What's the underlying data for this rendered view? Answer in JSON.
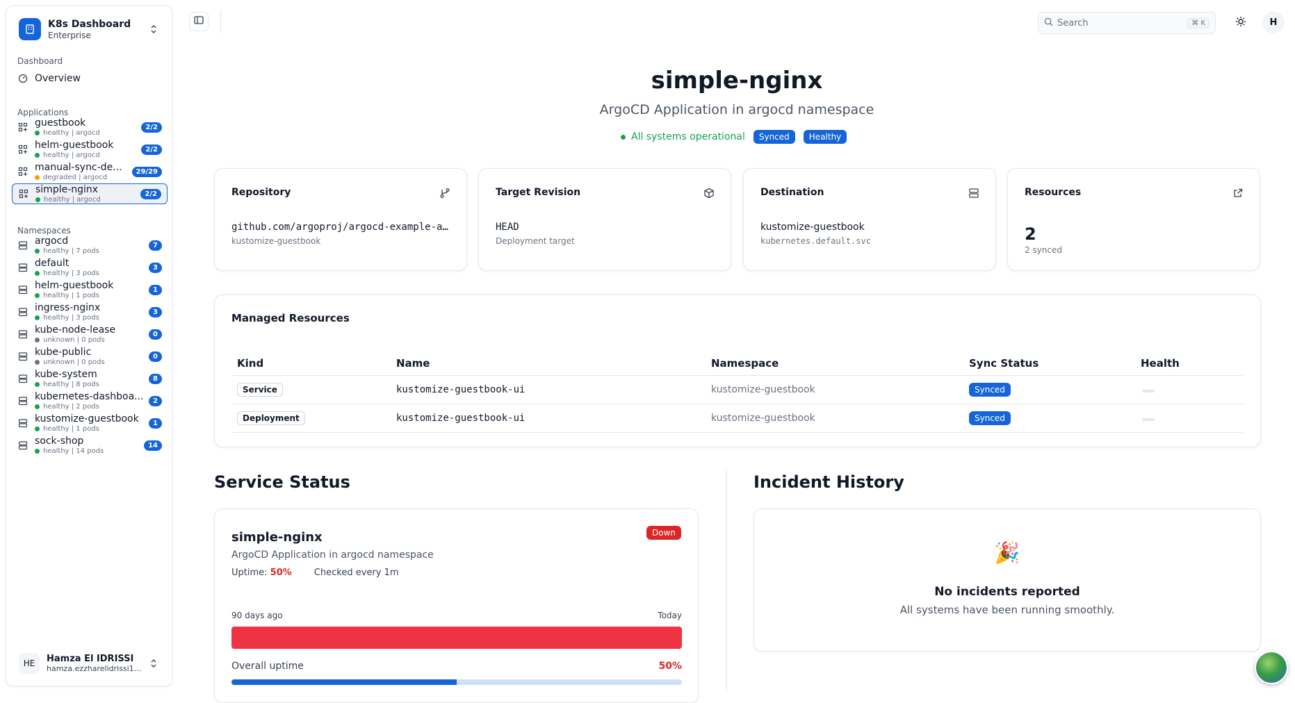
{
  "team": {
    "name": "K8s Dashboard",
    "plan": "Enterprise"
  },
  "sidebar": {
    "dashboard_label": "Dashboard",
    "overview_label": "Overview",
    "applications_label": "Applications",
    "applications": [
      {
        "name": "guestbook",
        "status": "healthy | argocd",
        "count": "2/2",
        "dot": "green"
      },
      {
        "name": "helm-guestbook",
        "status": "healthy | argocd",
        "count": "2/2",
        "dot": "green"
      },
      {
        "name": "manual-sync-de...",
        "status": "degraded | argocd",
        "count": "29/29",
        "dot": "orange"
      },
      {
        "name": "simple-nginx",
        "status": "healthy | argocd",
        "count": "2/2",
        "dot": "green",
        "active": true
      }
    ],
    "namespaces_label": "Namespaces",
    "namespaces": [
      {
        "name": "argocd",
        "status": "healthy | 7 pods",
        "count": "7",
        "dot": "green"
      },
      {
        "name": "default",
        "status": "healthy | 3 pods",
        "count": "3",
        "dot": "green"
      },
      {
        "name": "helm-guestbook",
        "status": "healthy | 1 pods",
        "count": "1",
        "dot": "green"
      },
      {
        "name": "ingress-nginx",
        "status": "healthy | 3 pods",
        "count": "3",
        "dot": "green"
      },
      {
        "name": "kube-node-lease",
        "status": "unknown | 0 pods",
        "count": "0",
        "dot": "gray"
      },
      {
        "name": "kube-public",
        "status": "unknown | 0 pods",
        "count": "0",
        "dot": "gray"
      },
      {
        "name": "kube-system",
        "status": "healthy | 8 pods",
        "count": "8",
        "dot": "green"
      },
      {
        "name": "kubernetes-dashboa...",
        "status": "healthy | 2 pods",
        "count": "2",
        "dot": "green"
      },
      {
        "name": "kustomize-guestbook",
        "status": "healthy | 1 pods",
        "count": "1",
        "dot": "green"
      },
      {
        "name": "sock-shop",
        "status": "healthy | 14 pods",
        "count": "14",
        "dot": "green"
      }
    ]
  },
  "user": {
    "initials": "HE",
    "name": "Hamza El IDRISSI",
    "email": "hamza.ezzharelidrissi1..."
  },
  "topbar": {
    "search_placeholder": "Search",
    "shortcut": "⌘ K",
    "avatar_initial": "H"
  },
  "hero": {
    "title": "simple-nginx",
    "subtitle": "ArgoCD Application in argocd namespace",
    "operational": "All systems operational",
    "badges": [
      "Synced",
      "Healthy"
    ]
  },
  "cards": {
    "repository": {
      "title": "Repository",
      "value": "github.com/argoproj/argocd-example-a...",
      "sub": "kustomize-guestbook",
      "icon": "git-branch-icon"
    },
    "revision": {
      "title": "Target Revision",
      "value": "HEAD",
      "sub": "Deployment target",
      "icon": "package-icon"
    },
    "destination": {
      "title": "Destination",
      "value": "kustomize-guestbook",
      "sub": "kubernetes.default.svc",
      "icon": "server-icon"
    },
    "resources": {
      "title": "Resources",
      "value": "2",
      "sub": "2 synced",
      "icon": "external-link-icon"
    }
  },
  "managed": {
    "title": "Managed Resources",
    "columns": [
      "Kind",
      "Name",
      "Namespace",
      "Sync Status",
      "Health"
    ],
    "rows": [
      {
        "kind": "Service",
        "name": "kustomize-guestbook-ui",
        "namespace": "kustomize-guestbook",
        "sync": "Synced"
      },
      {
        "kind": "Deployment",
        "name": "kustomize-guestbook-ui",
        "namespace": "kustomize-guestbook",
        "sync": "Synced"
      }
    ]
  },
  "service_status": {
    "heading": "Service Status",
    "name": "simple-nginx",
    "state": "Down",
    "description": "ArgoCD Application in argocd namespace",
    "uptime_label": "Uptime:",
    "uptime_value": "50%",
    "checked": "Checked every 1m",
    "range_start": "90 days ago",
    "range_end": "Today",
    "overall_label": "Overall uptime",
    "overall_value": "50%",
    "overall_fraction": 0.5
  },
  "incident": {
    "heading": "Incident History",
    "icon": "🎉",
    "title": "No incidents reported",
    "subtitle": "All systems have been running smoothly."
  },
  "colors": {
    "accent": "#1565d8",
    "healthy": "#16a34a",
    "degraded": "#f59e0b",
    "down": "#dc2626"
  }
}
